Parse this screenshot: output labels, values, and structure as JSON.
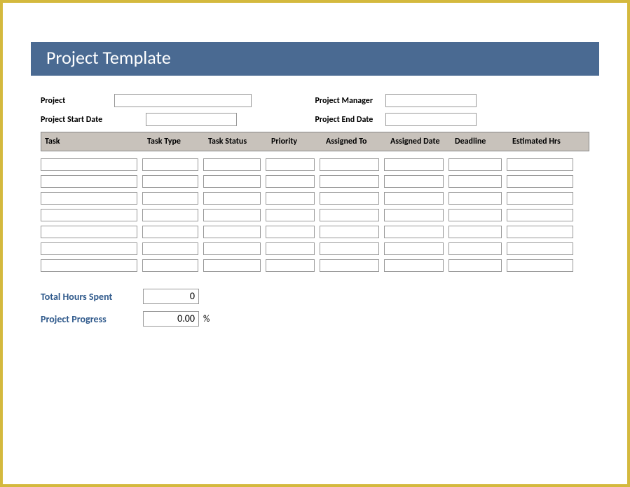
{
  "title": "Project Template",
  "meta": {
    "project_label": "Project",
    "project_value": "",
    "project_manager_label": "Project Manager",
    "project_manager_value": "",
    "project_start_date_label": "Project Start Date",
    "project_start_date_value": "",
    "project_end_date_label": "Project End Date",
    "project_end_date_value": ""
  },
  "columns": {
    "task": "Task",
    "task_type": "Task Type",
    "task_status": "Task Status",
    "priority": "Priority",
    "assigned_to": "Assigned To",
    "assigned_date": "Assigned Date",
    "deadline": "Deadline",
    "estimated_hrs": "Estimated Hrs"
  },
  "rows": [
    {
      "task": "",
      "task_type": "",
      "task_status": "",
      "priority": "",
      "assigned_to": "",
      "assigned_date": "",
      "deadline": "",
      "estimated_hrs": ""
    },
    {
      "task": "",
      "task_type": "",
      "task_status": "",
      "priority": "",
      "assigned_to": "",
      "assigned_date": "",
      "deadline": "",
      "estimated_hrs": ""
    },
    {
      "task": "",
      "task_type": "",
      "task_status": "",
      "priority": "",
      "assigned_to": "",
      "assigned_date": "",
      "deadline": "",
      "estimated_hrs": ""
    },
    {
      "task": "",
      "task_type": "",
      "task_status": "",
      "priority": "",
      "assigned_to": "",
      "assigned_date": "",
      "deadline": "",
      "estimated_hrs": ""
    },
    {
      "task": "",
      "task_type": "",
      "task_status": "",
      "priority": "",
      "assigned_to": "",
      "assigned_date": "",
      "deadline": "",
      "estimated_hrs": ""
    },
    {
      "task": "",
      "task_type": "",
      "task_status": "",
      "priority": "",
      "assigned_to": "",
      "assigned_date": "",
      "deadline": "",
      "estimated_hrs": ""
    },
    {
      "task": "",
      "task_type": "",
      "task_status": "",
      "priority": "",
      "assigned_to": "",
      "assigned_date": "",
      "deadline": "",
      "estimated_hrs": ""
    }
  ],
  "summary": {
    "total_hours_label": "Total Hours Spent",
    "total_hours_value": "0",
    "progress_label": "Project Progress",
    "progress_value": "0.00",
    "progress_unit": "%"
  }
}
